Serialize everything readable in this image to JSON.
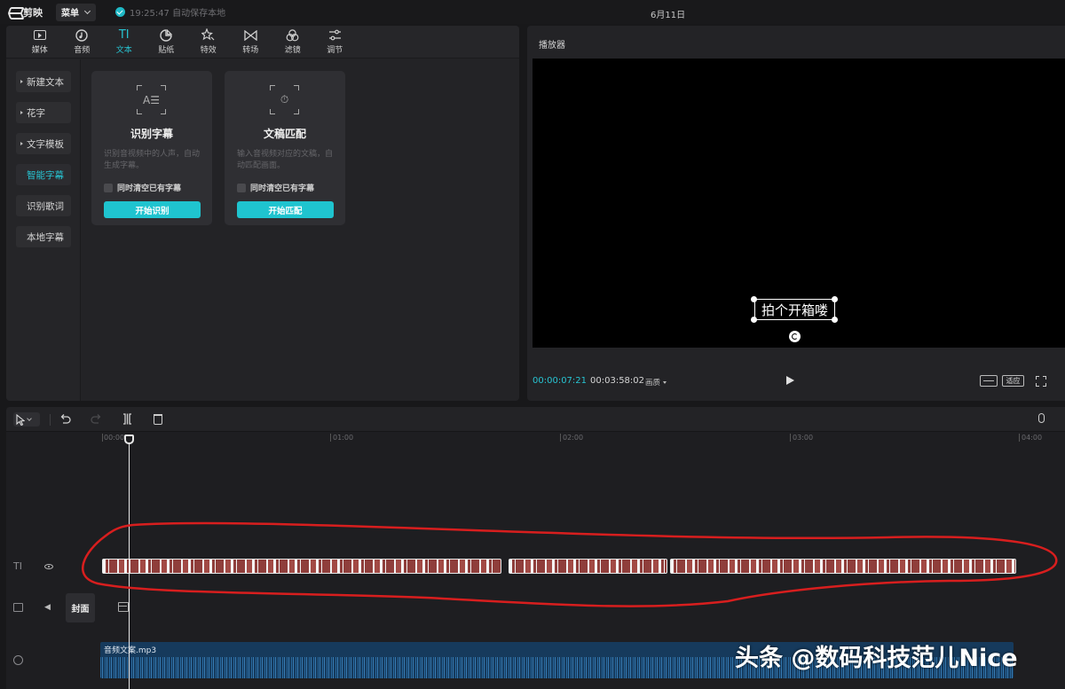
{
  "topbar": {
    "logo_text": "剪映",
    "menu_label": "菜单",
    "save_status": "19:25:47 自动保存本地",
    "project_date": "6月11日"
  },
  "toolbar": {
    "items": [
      {
        "label": "媒体",
        "icon": "media-icon"
      },
      {
        "label": "音频",
        "icon": "audio-icon"
      },
      {
        "label": "文本",
        "icon": "text-icon",
        "active": true
      },
      {
        "label": "贴纸",
        "icon": "sticker-icon"
      },
      {
        "label": "特效",
        "icon": "effects-icon"
      },
      {
        "label": "转场",
        "icon": "transition-icon"
      },
      {
        "label": "滤镜",
        "icon": "filter-icon"
      },
      {
        "label": "调节",
        "icon": "adjust-icon"
      }
    ],
    "text_glyph": "TI"
  },
  "subnav": {
    "items": [
      {
        "label": "新建文本",
        "arrow": true
      },
      {
        "label": "花字",
        "arrow": true
      },
      {
        "label": "文字模板",
        "arrow": true
      },
      {
        "label": "智能字幕",
        "active": true
      },
      {
        "label": "识别歌词"
      },
      {
        "label": "本地字幕"
      }
    ]
  },
  "cards": [
    {
      "title": "识别字幕",
      "desc": "识别音视频中的人声，自动生成字幕。",
      "checkbox_label": "同时清空已有字幕",
      "button": "开始识别",
      "glyph": "A☰"
    },
    {
      "title": "文稿匹配",
      "desc": "输入音视频对应的文稿，自动匹配画面。",
      "checkbox_label": "同时清空已有字幕",
      "button": "开始匹配",
      "glyph": "⏱"
    }
  ],
  "player": {
    "title": "播放器",
    "subtitle_text": "拍个开箱喽",
    "current_time": "00:00:07:21",
    "total_time": "00:03:58:02",
    "quality_label": "画质",
    "fit_label": "适应"
  },
  "timeline": {
    "ruler_labels": [
      "00:00",
      "01:00",
      "02:00",
      "03:00",
      "04:00"
    ],
    "text_track_icon": "TI",
    "cover_label": "封面",
    "audio_clip_name": "音频文案.mp3",
    "accent_color": "#1fc4cf",
    "annotation_color": "#d81e1e"
  },
  "watermark": "头条 @数码科技范儿Nice"
}
